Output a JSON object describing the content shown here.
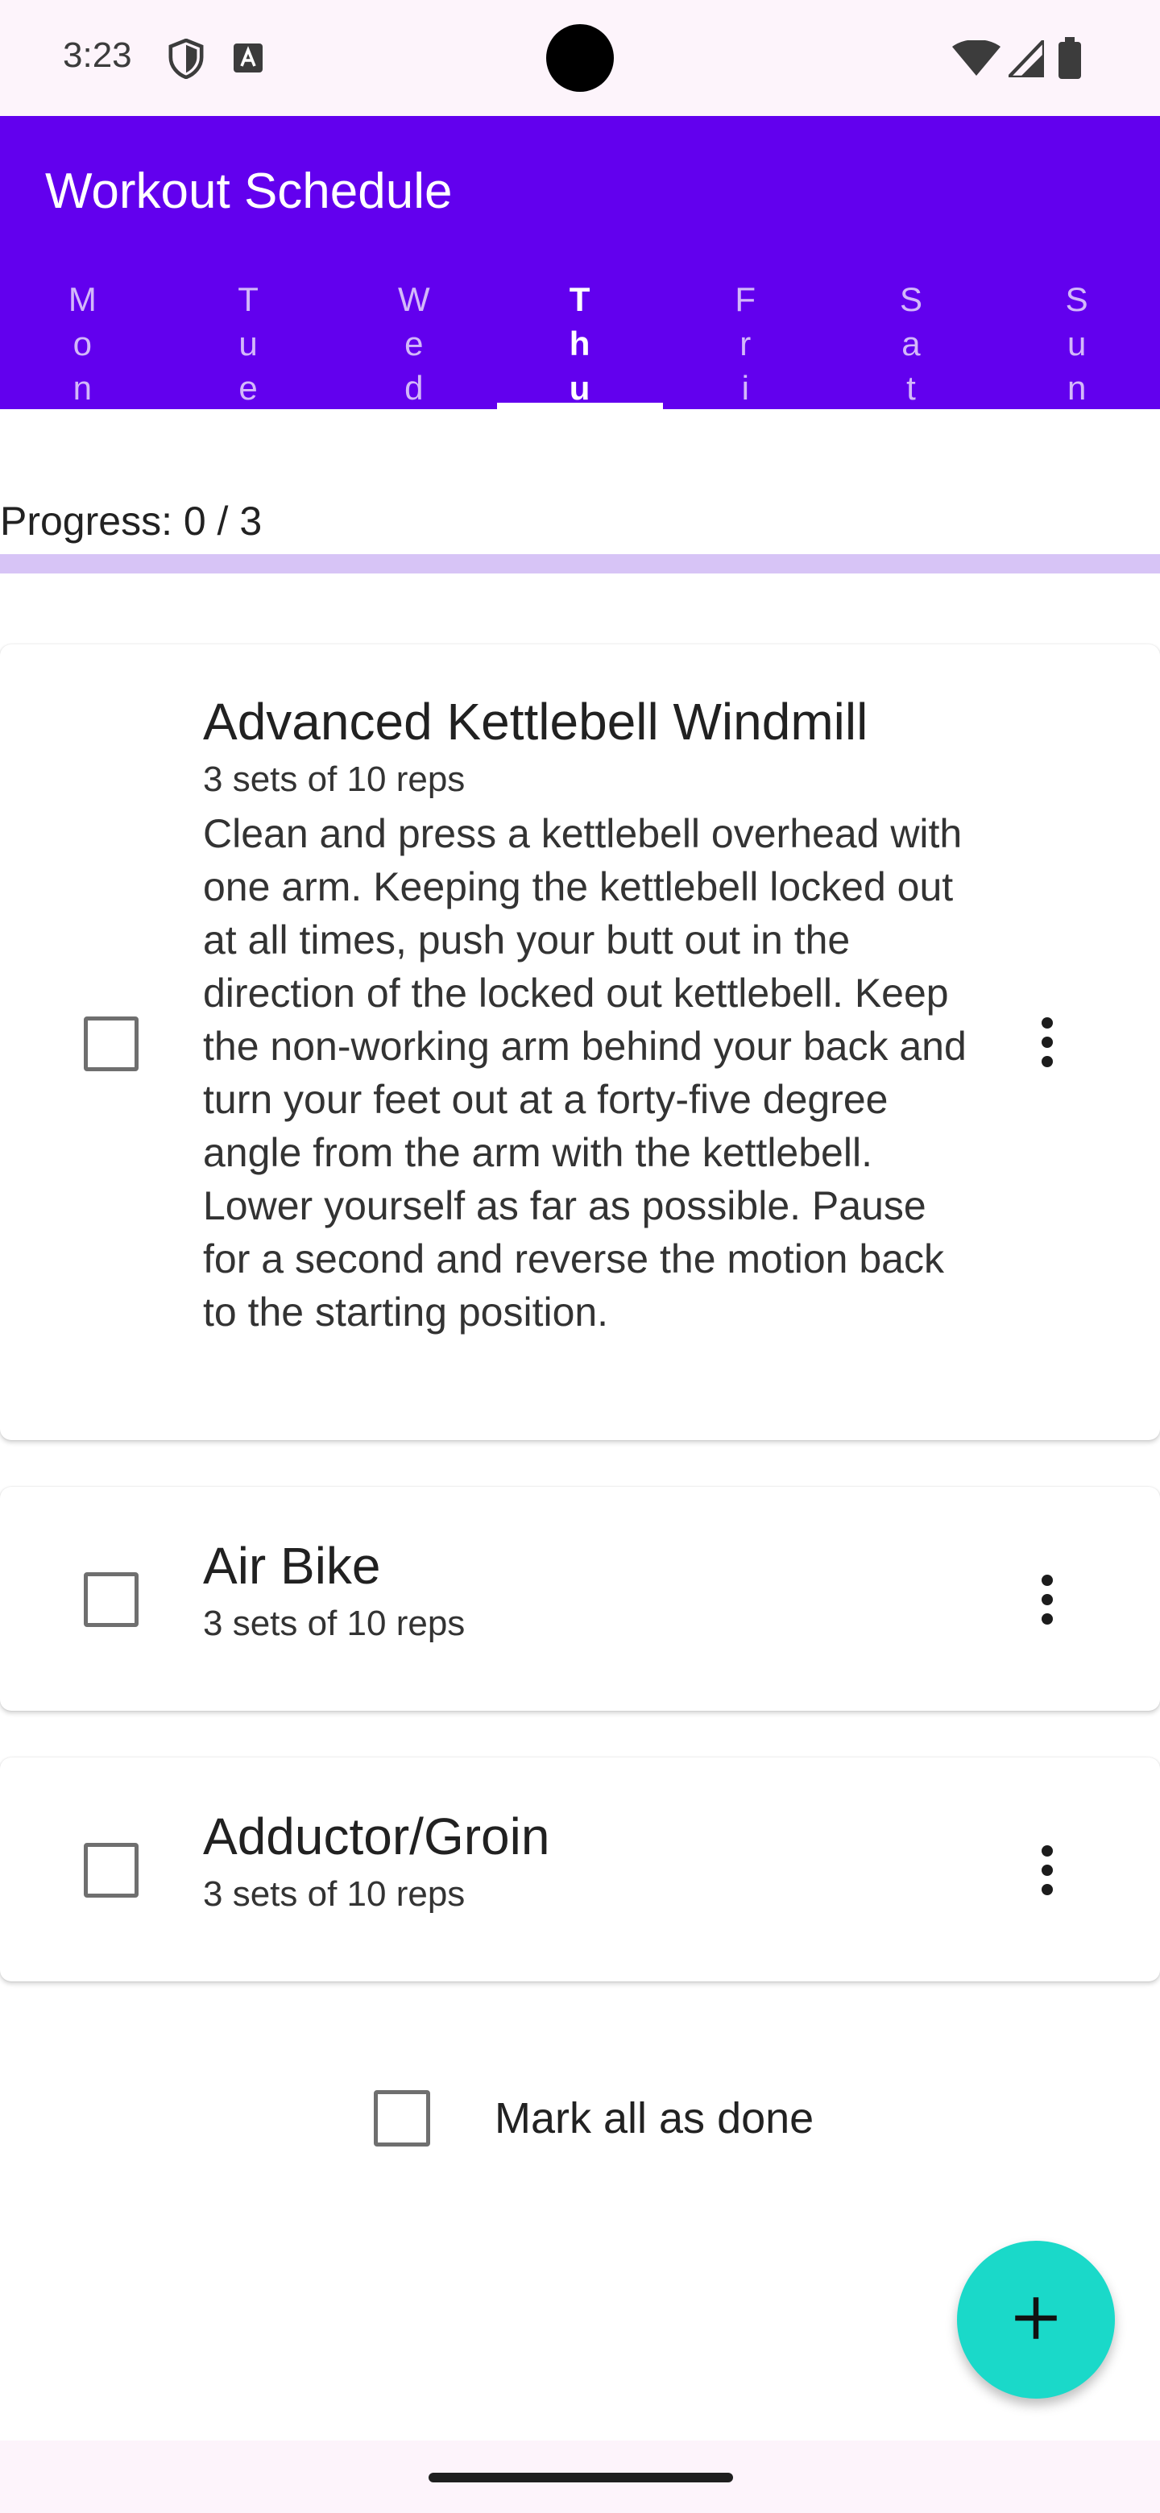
{
  "status_bar": {
    "time": "3:23"
  },
  "app_bar": {
    "title": "Workout Schedule"
  },
  "tabs": [
    {
      "label": "Mon",
      "active": false
    },
    {
      "label": "Tue",
      "active": false
    },
    {
      "label": "Wed",
      "active": false
    },
    {
      "label": "Thu",
      "active": true
    },
    {
      "label": "Fri",
      "active": false
    },
    {
      "label": "Sat",
      "active": false
    },
    {
      "label": "Sun",
      "active": false
    }
  ],
  "progress": {
    "label": "Progress: 0 / 3",
    "done": 0,
    "total": 3
  },
  "exercises": [
    {
      "title": "Advanced Kettlebell Windmill",
      "sets": "3 sets of 10 reps",
      "description": "Clean and press a kettlebell overhead with one arm. Keeping the kettlebell locked out at all times, push your butt out in the direction of the locked out kettlebell. Keep the non-working arm behind your back and turn your feet out at a forty-five degree angle from the arm with the kettlebell. Lower yourself as far as possible. Pause for a second and reverse the motion back to the starting position.",
      "checked": false
    },
    {
      "title": "Air Bike",
      "sets": "3 sets of 10 reps",
      "checked": false
    },
    {
      "title": "Adductor/Groin",
      "sets": "3 sets of 10 reps",
      "checked": false
    }
  ],
  "mark_all": {
    "label": "Mark all as done",
    "checked": false
  },
  "colors": {
    "primary": "#6200ee",
    "fab": "#1ad9c9",
    "progress_track": "#d7c4f6"
  },
  "icons": {
    "menu": "more-vert-icon",
    "fab": "add-icon"
  }
}
